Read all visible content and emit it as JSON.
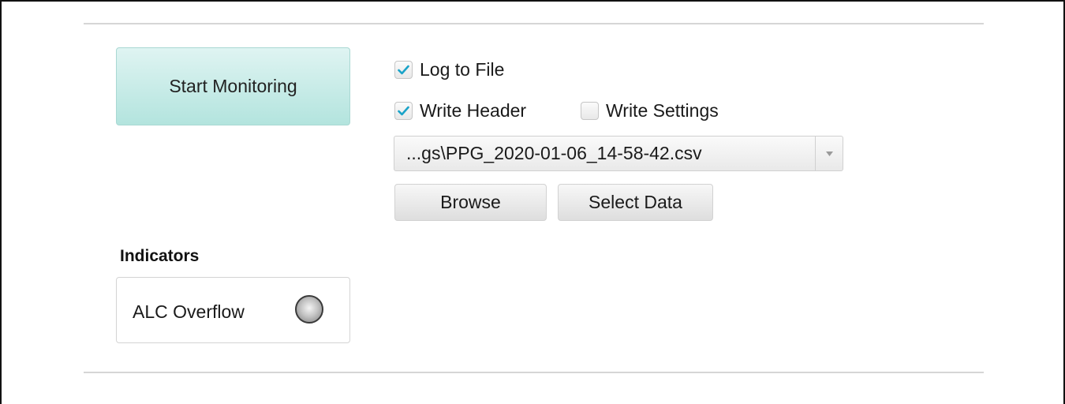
{
  "controls": {
    "start_label": "Start Monitoring"
  },
  "logging": {
    "log_to_file": {
      "label": "Log to File",
      "checked": true
    },
    "write_header": {
      "label": "Write Header",
      "checked": true
    },
    "write_settings": {
      "label": "Write Settings",
      "checked": false
    },
    "file_path": "...gs\\PPG_2020-01-06_14-58-42.csv",
    "browse_label": "Browse",
    "select_data_label": "Select Data"
  },
  "indicators": {
    "title": "Indicators",
    "items": [
      {
        "label": "ALC Overflow",
        "state": "off"
      }
    ]
  },
  "colors": {
    "accent_check": "#1aa3c8",
    "start_button_top": "#dff4f2",
    "start_button_bottom": "#b3e4de",
    "led_off": "#a8a8a8"
  },
  "icons": {
    "checkmark": "check-icon",
    "dropdown": "caret-down-icon",
    "indicator": "led-icon"
  }
}
